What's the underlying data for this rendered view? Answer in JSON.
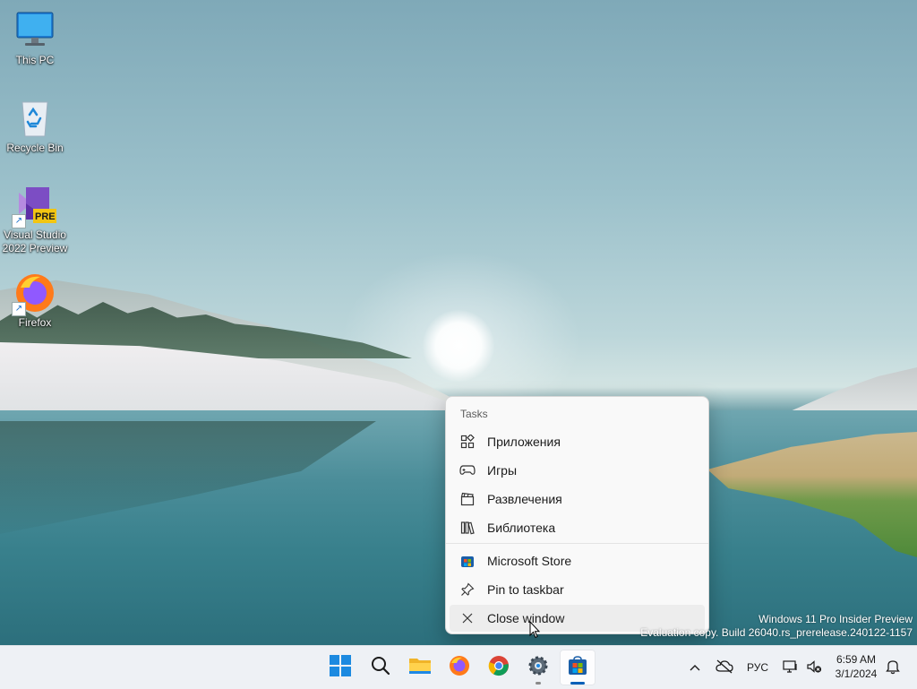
{
  "desktop": {
    "icons": [
      {
        "label": "This PC",
        "icon": "monitor-icon"
      },
      {
        "label": "Recycle Bin",
        "icon": "recycle-bin-icon"
      },
      {
        "label_line1": "Visual Studio",
        "label_line2": "2022 Preview",
        "badge": "PRE",
        "icon": "visual-studio-icon"
      },
      {
        "label": "Firefox",
        "icon": "firefox-icon"
      }
    ]
  },
  "context_menu": {
    "header": "Tasks",
    "items": [
      {
        "label": "Приложения",
        "icon": "apps-icon"
      },
      {
        "label": "Игры",
        "icon": "gamepad-icon"
      },
      {
        "label": "Развлечения",
        "icon": "clapperboard-icon"
      },
      {
        "label": "Библиотека",
        "icon": "library-icon"
      },
      {
        "label": "Microsoft Store",
        "icon": "store-icon"
      },
      {
        "label": "Pin to taskbar",
        "icon": "pin-icon"
      },
      {
        "label": "Close window",
        "icon": "close-icon"
      }
    ]
  },
  "watermark": {
    "line1": "Windows 11 Pro Insider Preview",
    "line2": "Evaluation copy. Build 26040.rs_prerelease.240122-1157"
  },
  "taskbar": {
    "apps": [
      "start-icon",
      "search-icon",
      "file-explorer-icon",
      "firefox-icon",
      "chrome-icon",
      "settings-icon",
      "store-icon"
    ],
    "active_app": "Microsoft Store",
    "accent": "#005fb8"
  },
  "tray": {
    "language": "РУС",
    "time": "6:59 AM",
    "date": "3/1/2024"
  }
}
